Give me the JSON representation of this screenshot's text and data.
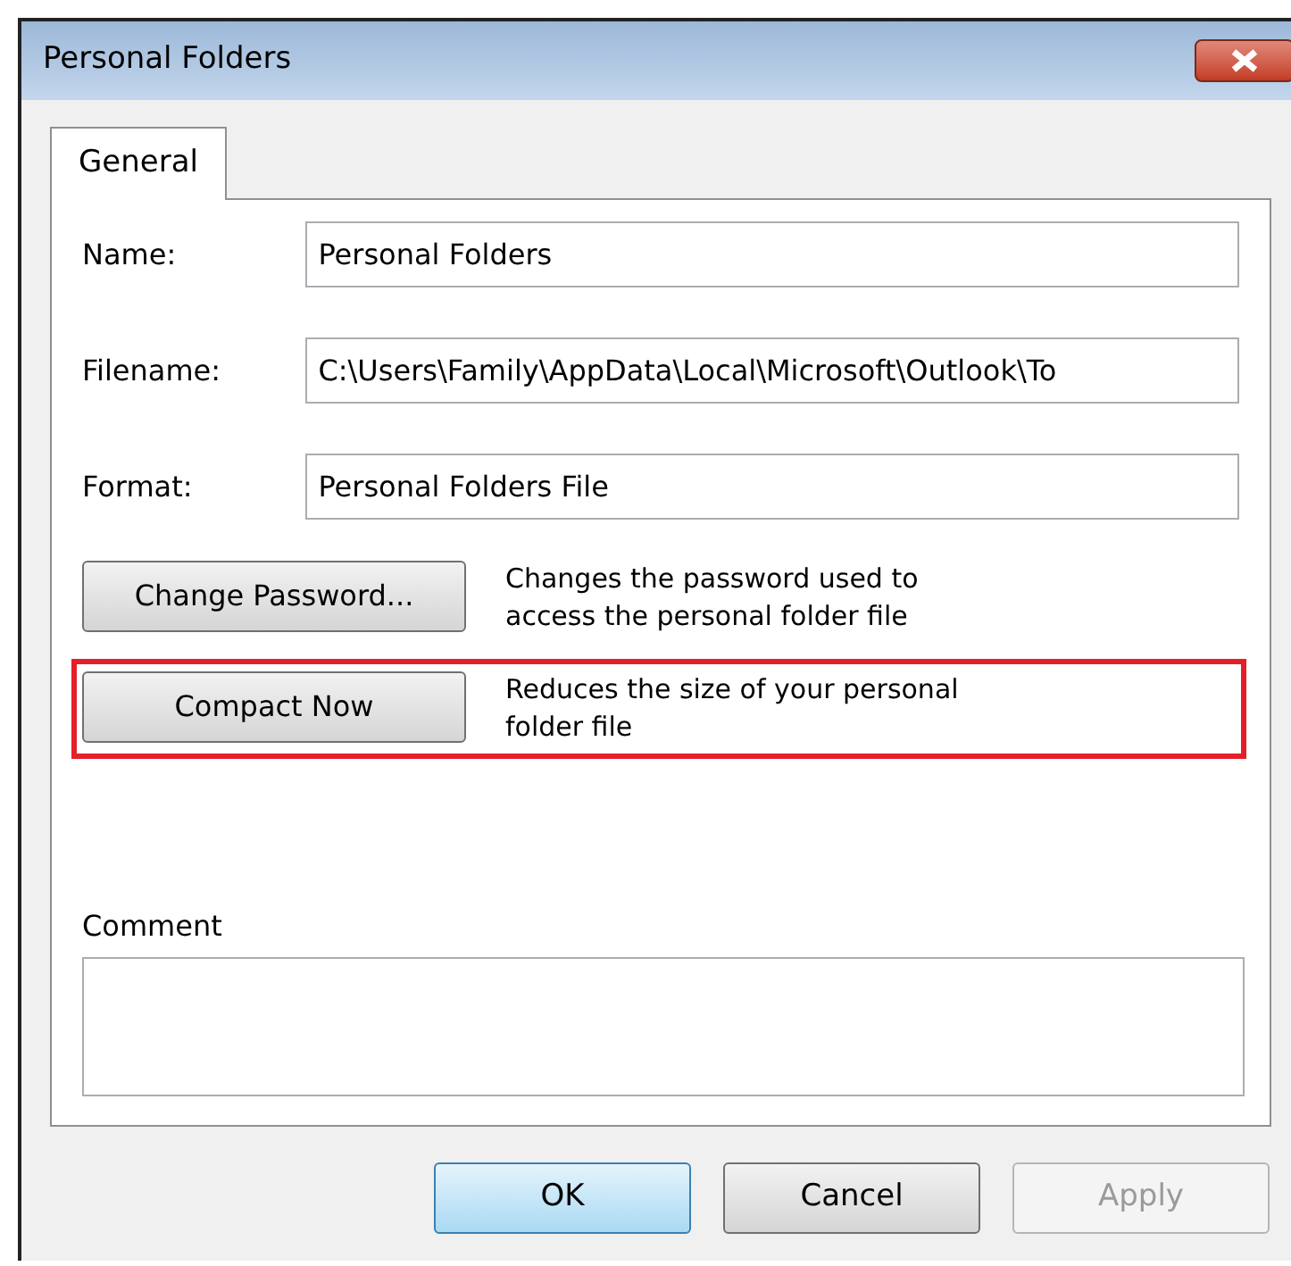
{
  "window": {
    "title": "Personal Folders"
  },
  "tabs": [
    {
      "label": "General",
      "selected": true
    }
  ],
  "fields": [
    {
      "label": "Name:",
      "value": "Personal Folders"
    },
    {
      "label": "Filename:",
      "value": "C:\\Users\\Family\\AppData\\Local\\Microsoft\\Outlook\\To"
    },
    {
      "label": "Format:",
      "value": "Personal Folders File"
    }
  ],
  "actions": [
    {
      "button": "Change Password...",
      "description": "Changes the password used to access the personal folder file",
      "highlighted": false
    },
    {
      "button": "Compact Now",
      "description": "Reduces the size of your personal folder file",
      "highlighted": true
    }
  ],
  "comment": {
    "label": "Comment"
  },
  "buttons": [
    {
      "label": "OK",
      "default": true,
      "disabled": false
    },
    {
      "label": "Cancel",
      "default": false,
      "disabled": false
    },
    {
      "label": "Apply",
      "default": false,
      "disabled": true
    }
  ]
}
